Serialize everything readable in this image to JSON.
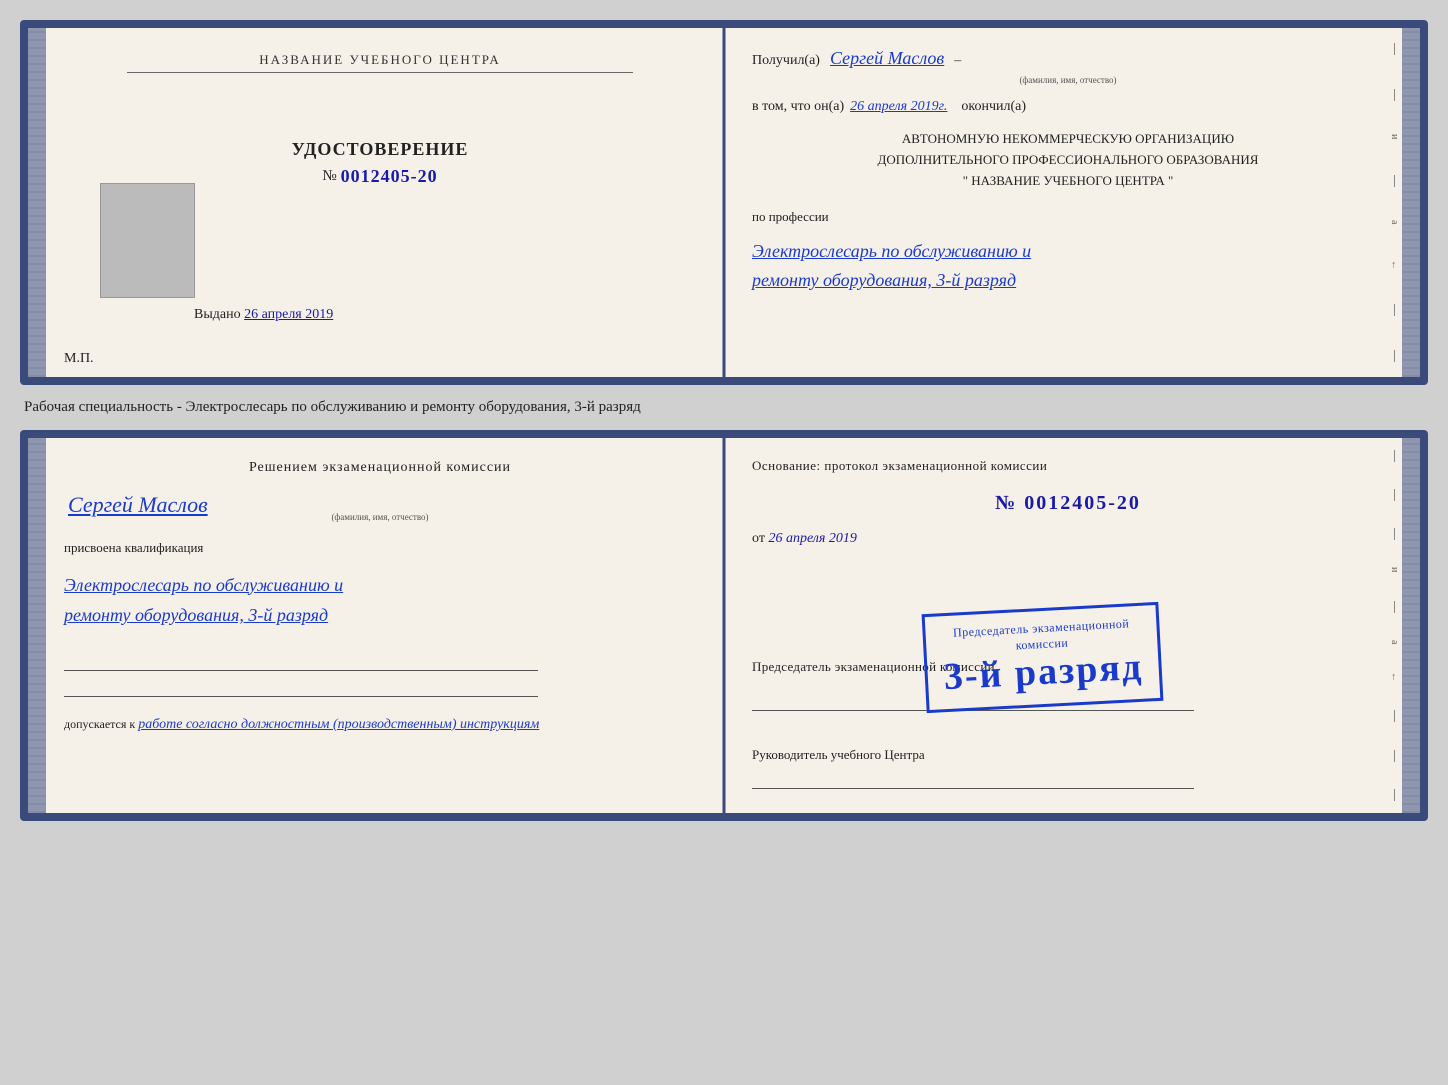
{
  "card_top": {
    "left": {
      "org_name": "НАЗВАНИЕ УЧЕБНОГО ЦЕНТРА",
      "cert_title": "УДОСТОВЕРЕНИЕ",
      "cert_number_prefix": "№",
      "cert_number": "0012405-20",
      "issued_label": "Выдано",
      "issued_date": "26 апреля 2019",
      "mp_label": "М.П."
    },
    "right": {
      "received_prefix": "Получил(а)",
      "recipient_name": "Сергей Маслов",
      "recipient_subtitle": "(фамилия, имя, отчество)",
      "in_that_prefix": "в том, что он(а)",
      "date_completed": "26 апреля 2019г.",
      "completed_suffix": "окончил(а)",
      "org_line1": "АВТОНОМНУЮ НЕКОММЕРЧЕСКУЮ ОРГАНИЗАЦИЮ",
      "org_line2": "ДОПОЛНИТЕЛЬНОГО ПРОФЕССИОНАЛЬНОГО ОБРАЗОВАНИЯ",
      "org_line3": "\"   НАЗВАНИЕ УЧЕБНОГО ЦЕНТРА   \"",
      "profession_label": "по профессии",
      "profession_value": "Электрослесарь по обслуживанию и",
      "profession_value2": "ремонту оборудования, 3-й разряд"
    }
  },
  "description": "Рабочая специальность - Электрослесарь по обслуживанию и ремонту оборудования, 3-й разряд",
  "card_bottom": {
    "left": {
      "commission_title": "Решением экзаменационной комиссии",
      "person_name": "Сергей Маслов",
      "person_subtitle": "(фамилия, имя, отчество)",
      "qualification_label": "присвоена квалификация",
      "qualification_value": "Электрослесарь по обслуживанию и",
      "qualification_value2": "ремонту оборудования, 3-й разряд",
      "allowed_prefix": "допускается к",
      "allowed_value": "работе согласно должностным (производственным) инструкциям"
    },
    "right": {
      "basis_text": "Основание: протокол экзаменационной комиссии",
      "protocol_number": "№ 0012405-20",
      "date_prefix": "от",
      "protocol_date": "26 апреля 2019",
      "chairman_title": "Председатель экзаменационной комиссии",
      "head_title": "Руководитель учебного Центра"
    },
    "stamp": {
      "top_line1": "Председатель экзаменационной",
      "top_line2": "комиссии",
      "main_text": "3-й разряд"
    }
  }
}
